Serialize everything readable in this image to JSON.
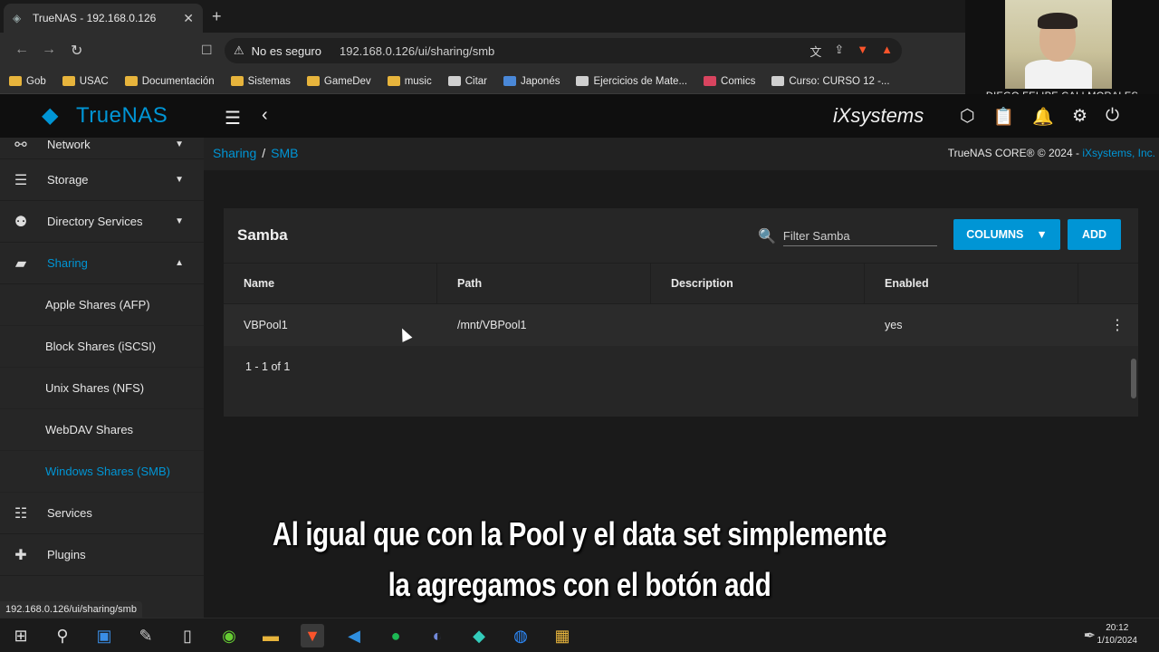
{
  "browser": {
    "tab_title": "TrueNAS - 192.168.0.126",
    "security_label": "No es seguro",
    "url": "192.168.0.126/ui/sharing/smb",
    "bookmarks": [
      "Gob",
      "USAC",
      "Documentación",
      "Sistemas",
      "GameDev",
      "music",
      "Citar",
      "Japonés",
      "Ejercicios de Mate...",
      "Comics",
      "Curso: CURSO 12 -..."
    ],
    "status_url": "192.168.0.126/ui/sharing/smb"
  },
  "webcam": {
    "name": "DIEGO FELIPE CALI MORALES"
  },
  "app": {
    "logo": "TrueNAS",
    "vendor_logo": "iXsystems",
    "breadcrumb": {
      "parent": "Sharing",
      "sep": "/",
      "current": "SMB"
    },
    "copyright": {
      "text": "TrueNAS CORE® © 2024 - ",
      "link": "iXsystems, Inc."
    }
  },
  "sidebar": {
    "items": [
      {
        "label": "Network",
        "icon": "network-icon"
      },
      {
        "label": "Storage",
        "icon": "storage-icon"
      },
      {
        "label": "Directory Services",
        "icon": "directory-icon"
      },
      {
        "label": "Sharing",
        "icon": "sharing-icon"
      },
      {
        "label": "Services",
        "icon": "services-icon"
      },
      {
        "label": "Plugins",
        "icon": "plugins-icon"
      }
    ],
    "sharing_subitems": [
      "Apple Shares (AFP)",
      "Block Shares (iSCSI)",
      "Unix Shares (NFS)",
      "WebDAV Shares",
      "Windows Shares (SMB)"
    ]
  },
  "card": {
    "title": "Samba",
    "filter_placeholder": "Filter Samba",
    "columns_label": "COLUMNS",
    "add_label": "ADD",
    "headers": [
      "Name",
      "Path",
      "Description",
      "Enabled"
    ],
    "rows": [
      {
        "name": "VBPool1",
        "path": "/mnt/VBPool1",
        "description": "",
        "enabled": "yes"
      }
    ],
    "pagination": "1 - 1 of 1"
  },
  "subtitle": {
    "line1": "Al igual que con la Pool y el data set simplemente",
    "line2": "la agregamos con el botón add"
  },
  "taskbar": {
    "time": "20:12",
    "date": "1/10/2024"
  },
  "colors": {
    "accent": "#0095d5",
    "brave": "#fb542b"
  }
}
